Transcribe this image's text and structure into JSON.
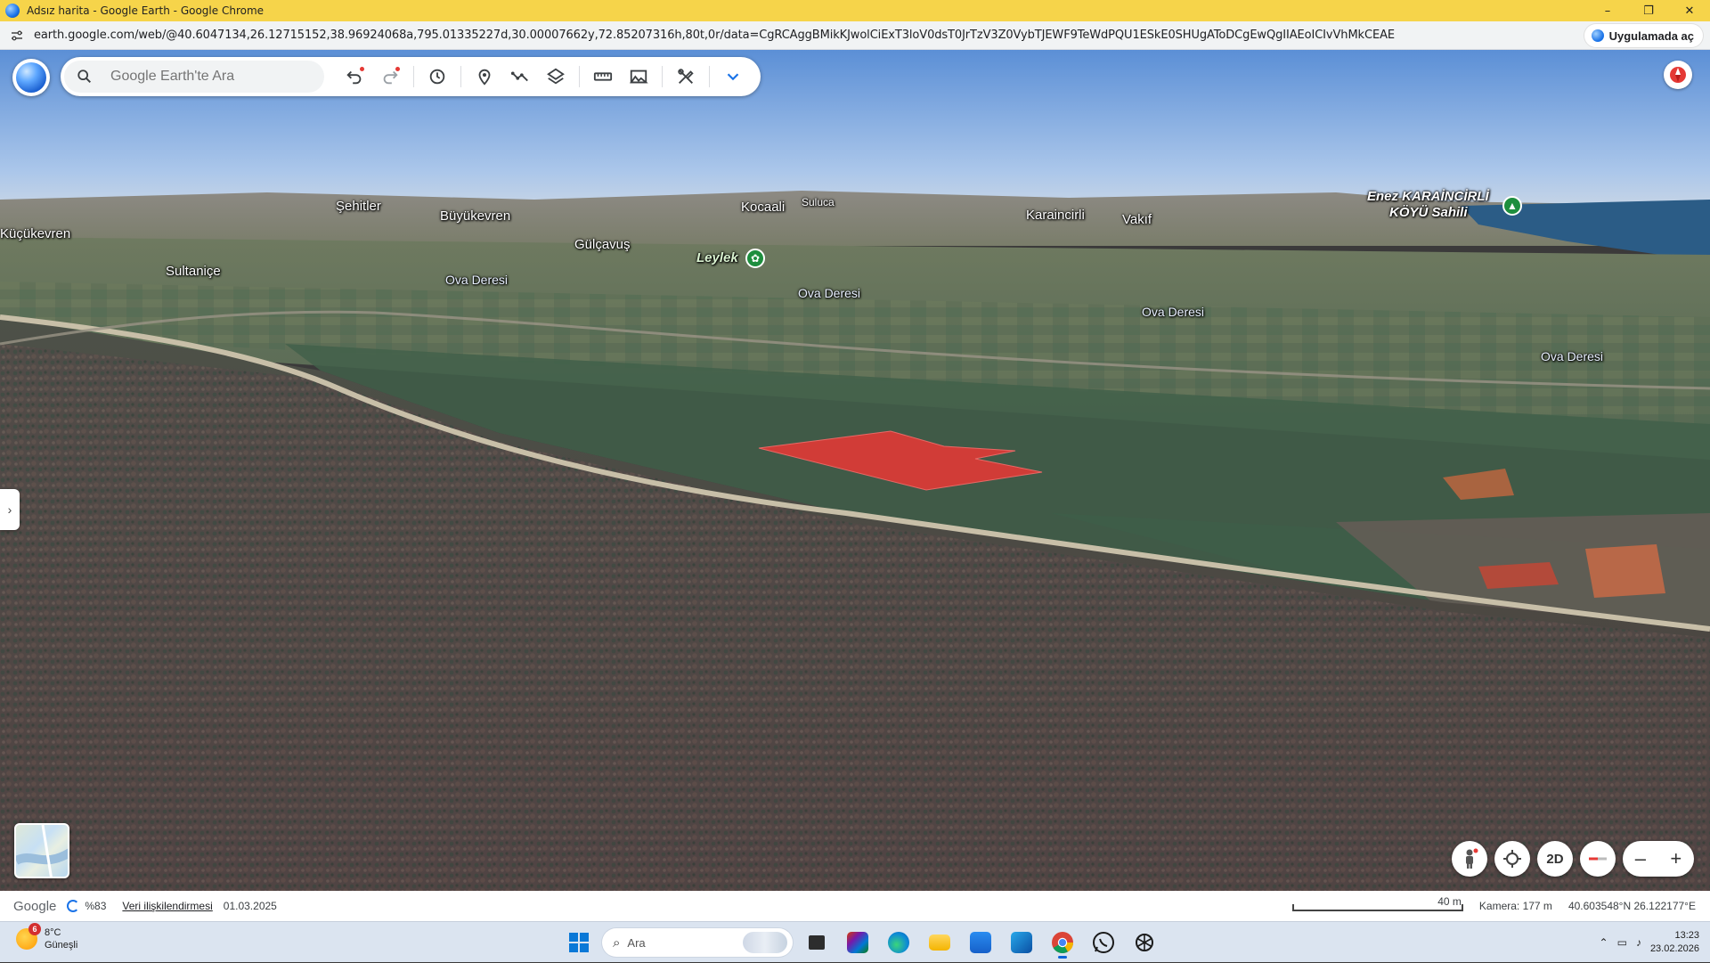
{
  "window": {
    "title": "Adsız harita - Google Earth - Google Chrome",
    "controls": [
      "–",
      "❐",
      "✕"
    ]
  },
  "browser": {
    "url": "earth.google.com/web/@40.6047134,26.12715152,38.96924068a,795.01335227d,30.00007662y,72.85207316h,80t,0r/data=CgRCAggBMikKJwolCiExT3loV0dsT0JrTzV3Z0VybTJEWF9TeWdPQU1ESkE0SHUgAToDCgEwQgIIAEoICIvVhMkCEAE",
    "open_in_app": "Uygulamada aç"
  },
  "toolbar": {
    "search_placeholder": "Google Earth'te Ara",
    "icons": [
      "search-icon",
      "undo-icon",
      "redo-icon",
      "history-icon",
      "pin-icon",
      "path-icon",
      "layers-icon",
      "ruler-icon",
      "image-icon",
      "tools-icon",
      "chevron-down-icon"
    ]
  },
  "map_labels": {
    "kucukevren": "Küçükevren",
    "sehitler": "Şehitler",
    "buyukevren": "Büyükevren",
    "kocaali": "Kocaali",
    "suluca": "Suluca",
    "karaincirli": "Karaincirli",
    "vakif": "Vakıf",
    "enez_line1": "Enez KARAİNCİRLİ",
    "enez_line2": "KÖYÜ Sahili",
    "gulcavus": "Gülçavuş",
    "leylek": "Leylek",
    "sultanice": "Sultaniçe",
    "ova1": "Ova Deresi",
    "ova2": "Ova Deresi",
    "ova3": "Ova Deresi",
    "ova4": "Ova Deresi"
  },
  "nav": {
    "mode_2d": "2D",
    "zoom_out": "–",
    "zoom_in": "+"
  },
  "status": {
    "brand": "Google",
    "loading": "%83",
    "data_link": "Veri ilişkilendirmesi",
    "imagery_date": "01.03.2025",
    "scale": "40 m",
    "camera": "Kamera: 177 m",
    "coords": "40.603548°N 26.122177°E"
  },
  "taskbar": {
    "temp": "8°C",
    "weather": "Güneşli",
    "weather_badge": "6",
    "search_label": "Ara",
    "time": "13:23",
    "date": "23.02.2026"
  },
  "colors": {
    "titlebar": "#f6d44a",
    "polygon": "#e53935",
    "accent": "#1a73e8"
  }
}
